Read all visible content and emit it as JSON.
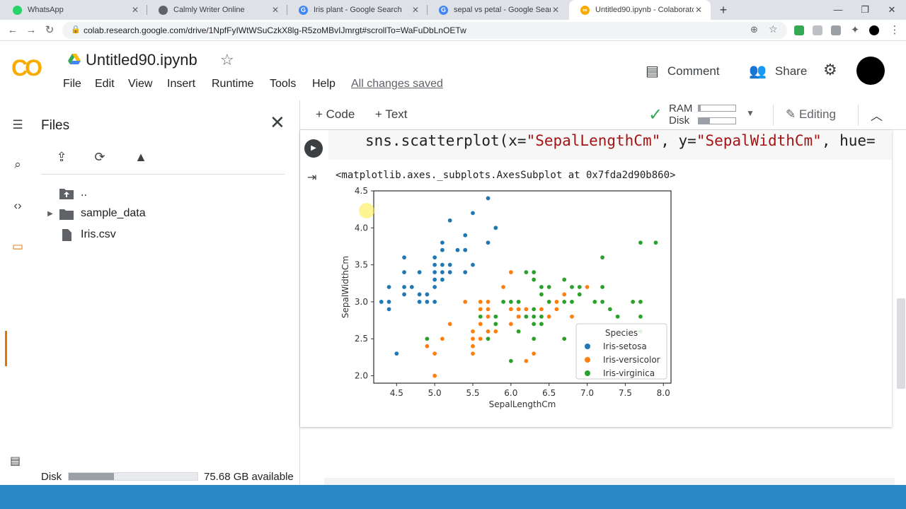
{
  "browser": {
    "tabs": [
      {
        "label": "WhatsApp",
        "color": "#25d366"
      },
      {
        "label": "Calmly Writer Online",
        "color": "#5f6368"
      },
      {
        "label": "Iris plant - Google Search",
        "color": "#4285f4"
      },
      {
        "label": "sepal vs petal - Google Search",
        "color": "#4285f4"
      },
      {
        "label": "Untitled90.ipynb - Colaboratory",
        "color": "#f9ab00"
      }
    ],
    "url": "colab.research.google.com/drive/1NpfFyIWtWSuCzkX8lg-R5zoMBvIJmrgt#scrollTo=WaFuDbLnOETw"
  },
  "header": {
    "notebook_title": "Untitled90.ipynb",
    "menu": [
      "File",
      "Edit",
      "View",
      "Insert",
      "Runtime",
      "Tools",
      "Help"
    ],
    "saved_status": "All changes saved",
    "comment_label": "Comment",
    "share_label": "Share"
  },
  "files": {
    "title": "Files",
    "items": [
      {
        "name": ".."
      },
      {
        "name": "sample_data"
      },
      {
        "name": "Iris.csv"
      }
    ],
    "disk_label": "Disk",
    "disk_available": "75.68 GB available",
    "disk_used_fraction": 0.35
  },
  "toolbar": {
    "code_label": "+ Code",
    "text_label": "+ Text",
    "ram_label": "RAM",
    "disk_label": "Disk",
    "ram_fraction": 0.05,
    "disk_fraction": 0.3,
    "editing_label": "Editing"
  },
  "cell": {
    "code_prefix": "sns.scatterplot(x=",
    "code_x": "\"SepalLengthCm\"",
    "code_mid": ", y=",
    "code_y": "\"SepalWidthCm\"",
    "code_suffix": ", hue=",
    "output_text": "<matplotlib.axes._subplots.AxesSubplot at 0x7fda2d90b860>"
  },
  "chart_data": {
    "type": "scatter",
    "xlabel": "SepalLengthCm",
    "ylabel": "SepalWidthCm",
    "xlim": [
      4.2,
      8.1
    ],
    "ylim": [
      1.9,
      4.5
    ],
    "xticks": [
      "4.5",
      "5.0",
      "5.5",
      "6.0",
      "6.5",
      "7.0",
      "7.5",
      "8.0"
    ],
    "yticks": [
      "2.0",
      "2.5",
      "3.0",
      "3.5",
      "4.0",
      "4.5"
    ],
    "legend_title": "Species",
    "legend_position": "lower-right",
    "series": [
      {
        "name": "Iris-setosa",
        "color": "#1f77b4",
        "points": [
          [
            4.3,
            3.0
          ],
          [
            4.4,
            2.9
          ],
          [
            4.4,
            3.0
          ],
          [
            4.4,
            3.2
          ],
          [
            4.5,
            2.3
          ],
          [
            4.6,
            3.1
          ],
          [
            4.6,
            3.2
          ],
          [
            4.6,
            3.4
          ],
          [
            4.6,
            3.6
          ],
          [
            4.7,
            3.2
          ],
          [
            4.8,
            3.0
          ],
          [
            4.8,
            3.1
          ],
          [
            4.8,
            3.4
          ],
          [
            4.9,
            3.0
          ],
          [
            4.9,
            3.1
          ],
          [
            5.0,
            3.0
          ],
          [
            5.0,
            3.2
          ],
          [
            5.0,
            3.3
          ],
          [
            5.0,
            3.4
          ],
          [
            5.0,
            3.5
          ],
          [
            5.0,
            3.6
          ],
          [
            5.1,
            3.3
          ],
          [
            5.1,
            3.4
          ],
          [
            5.1,
            3.5
          ],
          [
            5.1,
            3.7
          ],
          [
            5.1,
            3.8
          ],
          [
            5.2,
            3.4
          ],
          [
            5.2,
            3.5
          ],
          [
            5.2,
            4.1
          ],
          [
            5.3,
            3.7
          ],
          [
            5.4,
            3.4
          ],
          [
            5.4,
            3.7
          ],
          [
            5.4,
            3.9
          ],
          [
            5.5,
            3.5
          ],
          [
            5.5,
            4.2
          ],
          [
            5.7,
            3.8
          ],
          [
            5.7,
            4.4
          ],
          [
            5.8,
            4.0
          ]
        ]
      },
      {
        "name": "Iris-versicolor",
        "color": "#ff7f0e",
        "points": [
          [
            4.9,
            2.4
          ],
          [
            5.0,
            2.0
          ],
          [
            5.0,
            2.3
          ],
          [
            5.1,
            2.5
          ],
          [
            5.2,
            2.7
          ],
          [
            5.4,
            3.0
          ],
          [
            5.5,
            2.3
          ],
          [
            5.5,
            2.4
          ],
          [
            5.5,
            2.5
          ],
          [
            5.5,
            2.6
          ],
          [
            5.6,
            2.5
          ],
          [
            5.6,
            2.7
          ],
          [
            5.6,
            2.9
          ],
          [
            5.6,
            3.0
          ],
          [
            5.7,
            2.6
          ],
          [
            5.7,
            2.8
          ],
          [
            5.7,
            2.9
          ],
          [
            5.7,
            3.0
          ],
          [
            5.8,
            2.6
          ],
          [
            5.8,
            2.7
          ],
          [
            5.9,
            3.0
          ],
          [
            5.9,
            3.2
          ],
          [
            6.0,
            2.2
          ],
          [
            6.0,
            2.7
          ],
          [
            6.0,
            2.9
          ],
          [
            6.0,
            3.4
          ],
          [
            6.1,
            2.8
          ],
          [
            6.1,
            2.9
          ],
          [
            6.1,
            3.0
          ],
          [
            6.2,
            2.2
          ],
          [
            6.2,
            2.9
          ],
          [
            6.3,
            2.3
          ],
          [
            6.3,
            2.5
          ],
          [
            6.3,
            3.3
          ],
          [
            6.4,
            2.9
          ],
          [
            6.4,
            3.2
          ],
          [
            6.5,
            2.8
          ],
          [
            6.6,
            2.9
          ],
          [
            6.6,
            3.0
          ],
          [
            6.7,
            3.0
          ],
          [
            6.7,
            3.1
          ],
          [
            6.8,
            2.8
          ],
          [
            6.9,
            3.1
          ],
          [
            7.0,
            3.2
          ]
        ]
      },
      {
        "name": "Iris-virginica",
        "color": "#2ca02c",
        "points": [
          [
            4.9,
            2.5
          ],
          [
            5.6,
            2.8
          ],
          [
            5.7,
            2.5
          ],
          [
            5.8,
            2.7
          ],
          [
            5.8,
            2.8
          ],
          [
            5.9,
            3.0
          ],
          [
            6.0,
            2.2
          ],
          [
            6.0,
            3.0
          ],
          [
            6.1,
            2.6
          ],
          [
            6.1,
            3.0
          ],
          [
            6.2,
            2.8
          ],
          [
            6.2,
            3.4
          ],
          [
            6.3,
            2.5
          ],
          [
            6.3,
            2.7
          ],
          [
            6.3,
            2.8
          ],
          [
            6.3,
            2.9
          ],
          [
            6.3,
            3.3
          ],
          [
            6.3,
            3.4
          ],
          [
            6.4,
            2.7
          ],
          [
            6.4,
            2.8
          ],
          [
            6.4,
            3.1
          ],
          [
            6.4,
            3.2
          ],
          [
            6.5,
            3.0
          ],
          [
            6.5,
            3.2
          ],
          [
            6.7,
            2.5
          ],
          [
            6.7,
            3.0
          ],
          [
            6.7,
            3.3
          ],
          [
            6.8,
            3.0
          ],
          [
            6.8,
            3.2
          ],
          [
            6.9,
            3.1
          ],
          [
            6.9,
            3.2
          ],
          [
            7.1,
            3.0
          ],
          [
            7.2,
            3.0
          ],
          [
            7.2,
            3.2
          ],
          [
            7.2,
            3.6
          ],
          [
            7.3,
            2.9
          ],
          [
            7.4,
            2.8
          ],
          [
            7.6,
            3.0
          ],
          [
            7.7,
            2.6
          ],
          [
            7.7,
            2.8
          ],
          [
            7.7,
            3.0
          ],
          [
            7.7,
            3.8
          ],
          [
            7.9,
            3.8
          ]
        ]
      }
    ]
  }
}
